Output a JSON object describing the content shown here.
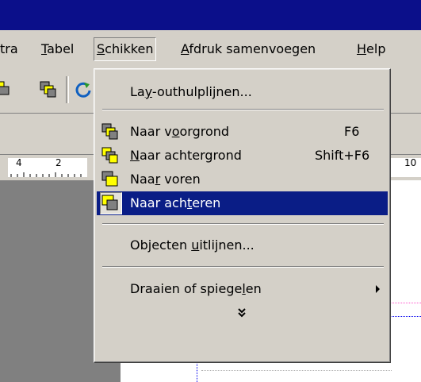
{
  "menubar": {
    "items": [
      {
        "label": "tra",
        "underline_index": -1
      },
      {
        "label_pre": "",
        "label_u": "T",
        "label_post": "abel"
      },
      {
        "label_pre": "",
        "label_u": "S",
        "label_post": "chikken"
      },
      {
        "label_pre": "",
        "label_u": "A",
        "label_post": "fdruk samenvoegen"
      },
      {
        "label_pre": "",
        "label_u": "H",
        "label_post": "elp"
      }
    ],
    "active": "Schikken"
  },
  "ruler": {
    "numbers": [
      "4",
      "2",
      "10"
    ]
  },
  "dropdown": {
    "items": [
      {
        "pre": "La",
        "u": "y",
        "post": "-outhulplijnen..."
      },
      {
        "pre": "Naar v",
        "u": "o",
        "post": "orgrond",
        "shortcut": "F6",
        "icon": "bring-to-front-icon"
      },
      {
        "pre": "",
        "u": "N",
        "post": "aar achtergrond",
        "shortcut": "Shift+F6",
        "icon": "send-to-back-icon"
      },
      {
        "pre": "Naa",
        "u": "r",
        "post": " voren",
        "icon": "bring-forward-icon"
      },
      {
        "pre": "Naar ach",
        "u": "t",
        "post": "eren",
        "icon": "send-backward-icon"
      },
      {
        "pre": "Objecten ",
        "u": "u",
        "post": "itlijnen..."
      },
      {
        "pre": "Draaien of spiege",
        "u": "l",
        "post": "en"
      }
    ],
    "expand_glyph": "»"
  },
  "colors": {
    "titlebar": "#0b0f8a",
    "selection": "#0a1d86",
    "face": "#d4d0c8"
  }
}
